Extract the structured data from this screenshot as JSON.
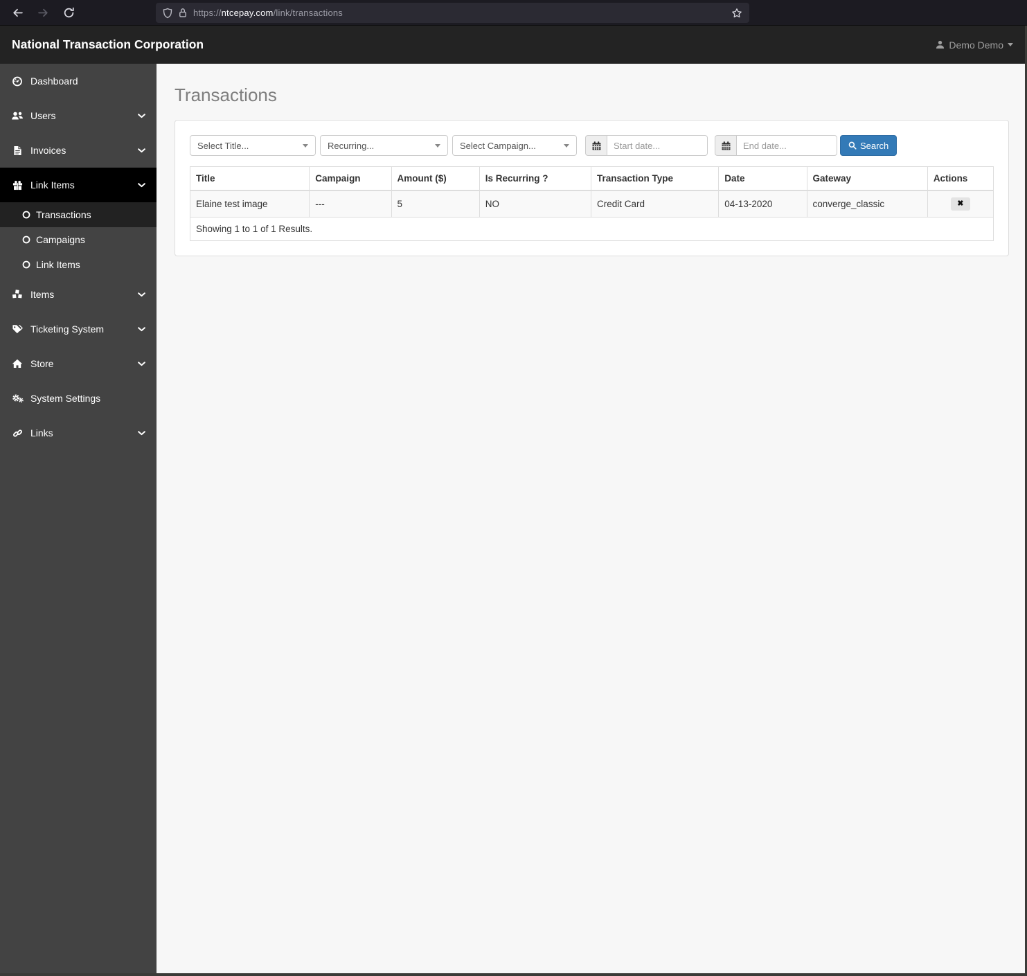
{
  "browser": {
    "url_prefix": "https://",
    "url_domain": "ntcepay.com",
    "url_path": "/link/transactions"
  },
  "header": {
    "brand": "National Transaction Corporation",
    "user_menu": "Demo Demo"
  },
  "sidebar": {
    "items": [
      {
        "label": "Dashboard",
        "icon": "dashboard-icon",
        "chevron": false
      },
      {
        "label": "Users",
        "icon": "users-icon",
        "chevron": true
      },
      {
        "label": "Invoices",
        "icon": "invoices-icon",
        "chevron": true
      },
      {
        "label": "Link Items",
        "icon": "gift-icon",
        "chevron": true,
        "active": true
      },
      {
        "label": "Items",
        "icon": "cubes-icon",
        "chevron": true
      },
      {
        "label": "Ticketing System",
        "icon": "tags-icon",
        "chevron": true
      },
      {
        "label": "Store",
        "icon": "home-icon",
        "chevron": true
      },
      {
        "label": "System Settings",
        "icon": "gears-icon",
        "chevron": false
      },
      {
        "label": "Links",
        "icon": "chain-icon",
        "chevron": true
      }
    ],
    "submenu": [
      {
        "label": "Transactions",
        "icon": "circle-icon",
        "current": true
      },
      {
        "label": "Campaigns",
        "icon": "circle-icon"
      },
      {
        "label": "Link Items",
        "icon": "circle-icon"
      }
    ]
  },
  "page": {
    "title": "Transactions"
  },
  "filters": {
    "title_select": "Select Title...",
    "recurring_select": "Recurring...",
    "campaign_select": "Select Campaign...",
    "start_date_placeholder": "Start date...",
    "end_date_placeholder": "End date...",
    "search_label": "Search"
  },
  "table": {
    "headers": [
      "Title",
      "Campaign",
      "Amount ($)",
      "Is Recurring ?",
      "Transaction Type",
      "Date",
      "Gateway",
      "Actions"
    ],
    "rows": [
      [
        "Elaine test image",
        "---",
        "5",
        "NO",
        "Credit Card",
        "04-13-2020",
        "converge_classic"
      ]
    ],
    "footer": "Showing 1 to 1 of 1 Results."
  },
  "icons": {
    "remove_glyph": "✖"
  },
  "colors": {
    "accent": "#337ab7",
    "sidebar": "#434343",
    "active_item": "#000000",
    "row_stripe": "#f9f9f9",
    "chrome": "#1c1b22"
  }
}
